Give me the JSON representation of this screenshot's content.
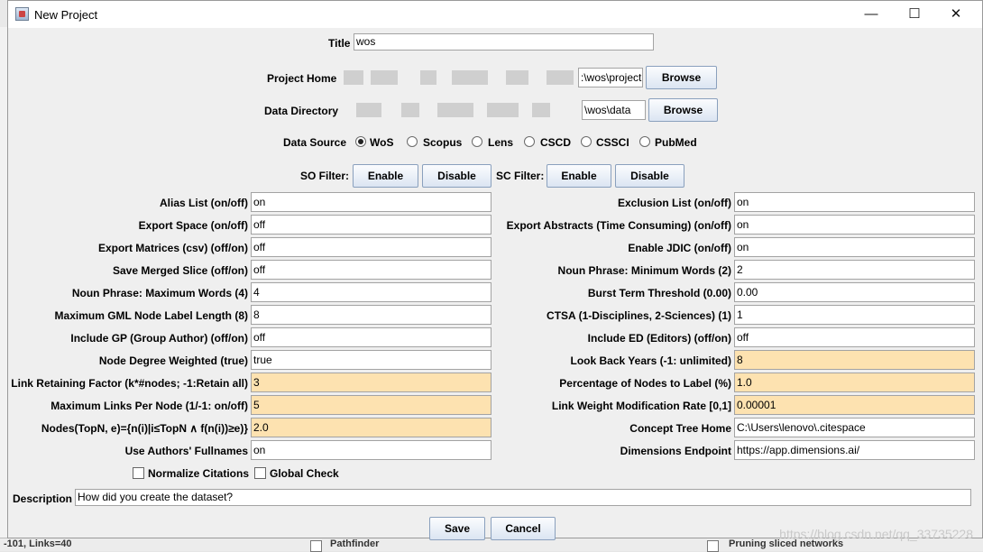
{
  "window": {
    "title": "New Project",
    "minimize": "—",
    "maximize": "☐",
    "close": "✕"
  },
  "title_row": {
    "label": "Title",
    "value": "wos"
  },
  "project_home": {
    "label": "Project Home",
    "value_visible": ":\\wos\\project",
    "browse": "Browse"
  },
  "data_directory": {
    "label": "Data Directory",
    "value_visible": "\\wos\\data",
    "browse": "Browse"
  },
  "data_source": {
    "label": "Data Source",
    "options": [
      "WoS",
      "Scopus",
      "Lens",
      "CSCD",
      "CSSCI",
      "PubMed"
    ],
    "selected": "WoS"
  },
  "filters": {
    "so_label": "SO Filter:",
    "sc_label": "SC Filter:",
    "enable": "Enable",
    "disable": "Disable"
  },
  "left_params": [
    {
      "label": "Alias List (on/off)",
      "value": "on"
    },
    {
      "label": "Export Space (on/off)",
      "value": "off"
    },
    {
      "label": "Export Matrices (csv) (off/on)",
      "value": "off"
    },
    {
      "label": "Save Merged Slice (off/on)",
      "value": "off"
    },
    {
      "label": "Noun Phrase: Maximum Words (4)",
      "value": "4"
    },
    {
      "label": "Maximum GML Node Label Length (8)",
      "value": "8"
    },
    {
      "label": "Include GP (Group Author) (off/on)",
      "value": "off"
    },
    {
      "label": "Node Degree Weighted (true)",
      "value": "true"
    },
    {
      "label": "Link Retaining Factor (k*#nodes; -1:Retain all)",
      "value": "3"
    },
    {
      "label": "Maximum Links Per Node (1/-1: on/off)",
      "value": "5"
    },
    {
      "label": "Nodes(TopN, e)={n(i)|i≤TopN ∧ f(n(i))≥e)}",
      "value": "2.0"
    },
    {
      "label": "Use Authors' Fullnames",
      "value": "on"
    }
  ],
  "right_params": [
    {
      "label": "Exclusion List (on/off)",
      "value": "on"
    },
    {
      "label": "Export Abstracts (Time Consuming) (on/off)",
      "value": "on"
    },
    {
      "label": "Enable JDIC (on/off)",
      "value": "on"
    },
    {
      "label": "Noun Phrase: Minimum Words (2)",
      "value": "2"
    },
    {
      "label": "Burst Term Threshold (0.00)",
      "value": "0.00"
    },
    {
      "label": "CTSA (1-Disciplines, 2-Sciences) (1)",
      "value": "1"
    },
    {
      "label": "Include ED (Editors) (off/on)",
      "value": "off"
    },
    {
      "label": "Look Back Years (-1: unlimited)",
      "value": "8"
    },
    {
      "label": "Percentage of Nodes to Label (%)",
      "value": "1.0"
    },
    {
      "label": "Link Weight Modification Rate [0,1]",
      "value": "0.00001"
    },
    {
      "label": "Concept Tree Home",
      "value": "C:\\Users\\lenovo\\.citespace"
    },
    {
      "label": "Dimensions Endpoint",
      "value": "https://app.dimensions.ai/"
    }
  ],
  "checks": {
    "normalize": "Normalize Citations",
    "global": "Global Check"
  },
  "description": {
    "label": "Description",
    "value": "How did you create the dataset?"
  },
  "actions": {
    "save": "Save",
    "cancel": "Cancel"
  },
  "background": {
    "links_text": "-101, Links=40",
    "pathfinder": "Pathfinder",
    "pruning": "Pruning sliced networks"
  },
  "watermark": "https://blog.csdn.net/qq_33735228",
  "colors": {
    "highlight": "#fde2b0",
    "button_top": "#fbfcfe",
    "button_bottom": "#dbe5f2"
  }
}
